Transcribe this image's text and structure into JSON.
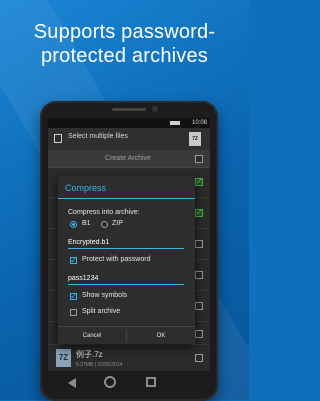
{
  "headline": {
    "line1": "Supports password-",
    "line2": "protected archives"
  },
  "status_bar": {
    "time": "10:08"
  },
  "action_bar": {
    "title": "Select multiple files",
    "archive_icon_text": "7Z"
  },
  "toolbar": {
    "create_archive_label": "Create Archive"
  },
  "dialog": {
    "title": "Compress",
    "compress_into_label": "Compress into archive:",
    "formats": [
      {
        "label": "B1",
        "selected": true
      },
      {
        "label": "ZIP",
        "selected": false
      }
    ],
    "filename_value": "Encrypted.b1",
    "protect_label": "Protect with password",
    "protect_checked": true,
    "password_value": "pass1234",
    "show_symbols_label": "Show symbols",
    "show_symbols_checked": true,
    "split_label": "Split archive",
    "split_checked": false,
    "cancel_label": "Cancel",
    "ok_label": "OK"
  },
  "list": {
    "last_item": {
      "name": "例子.7z",
      "meta": "5.37MB | 22/05/2014",
      "icon_text": "7Z"
    },
    "checked_rows": [
      false,
      true,
      true,
      false,
      false,
      false,
      false
    ]
  },
  "colors": {
    "accent": "#33b5e5",
    "background": "#0e6fbb",
    "check_green": "#6ccf3a"
  }
}
